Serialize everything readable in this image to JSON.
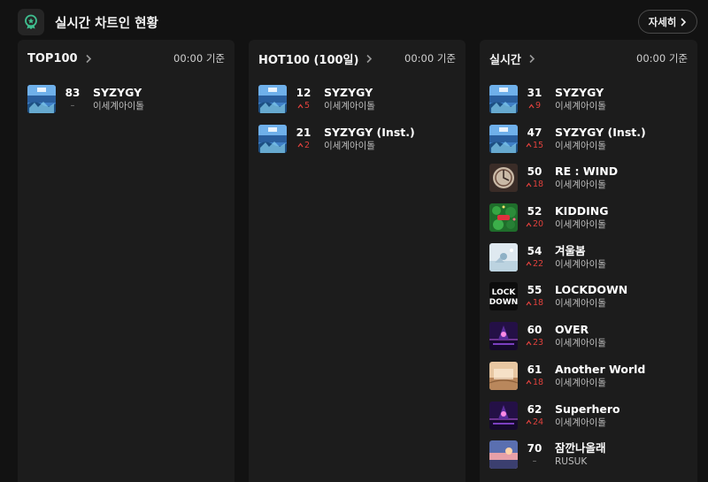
{
  "header": {
    "title": "실시간 차트인 현황",
    "detail_label": "자세히"
  },
  "panels": [
    {
      "name": "TOP100",
      "basis": "00:00 기준",
      "items": [
        {
          "rank": "83",
          "change": "–",
          "dir": "none",
          "title": "SYZYGY",
          "artist": "이세계아이돌",
          "art": "syzygy"
        }
      ]
    },
    {
      "name": "HOT100 (100일)",
      "basis": "00:00 기준",
      "items": [
        {
          "rank": "12",
          "change": "5",
          "dir": "up",
          "title": "SYZYGY",
          "artist": "이세계아이돌",
          "art": "syzygy"
        },
        {
          "rank": "21",
          "change": "2",
          "dir": "up",
          "title": "SYZYGY (Inst.)",
          "artist": "이세계아이돌",
          "art": "syzygy"
        }
      ]
    },
    {
      "name": "실시간",
      "basis": "00:00 기준",
      "items": [
        {
          "rank": "31",
          "change": "9",
          "dir": "up",
          "title": "SYZYGY",
          "artist": "이세계아이돌",
          "art": "syzygy"
        },
        {
          "rank": "47",
          "change": "15",
          "dir": "up",
          "title": "SYZYGY (Inst.)",
          "artist": "이세계아이돌",
          "art": "syzygy"
        },
        {
          "rank": "50",
          "change": "18",
          "dir": "up",
          "title": "RE : WIND",
          "artist": "이세계아이돌",
          "art": "rewind"
        },
        {
          "rank": "52",
          "change": "20",
          "dir": "up",
          "title": "KIDDING",
          "artist": "이세계아이돌",
          "art": "kidding"
        },
        {
          "rank": "54",
          "change": "22",
          "dir": "up",
          "title": "겨울봄",
          "artist": "이세계아이돌",
          "art": "winter"
        },
        {
          "rank": "55",
          "change": "18",
          "dir": "up",
          "title": "LOCKDOWN",
          "artist": "이세계아이돌",
          "art": "lockdown"
        },
        {
          "rank": "60",
          "change": "23",
          "dir": "up",
          "title": "OVER",
          "artist": "이세계아이돌",
          "art": "over"
        },
        {
          "rank": "61",
          "change": "18",
          "dir": "up",
          "title": "Another World",
          "artist": "이세계아이돌",
          "art": "another"
        },
        {
          "rank": "62",
          "change": "24",
          "dir": "up",
          "title": "Superhero",
          "artist": "이세계아이돌",
          "art": "over"
        },
        {
          "rank": "70",
          "change": "–",
          "dir": "none",
          "title": "잠깐나올래",
          "artist": "RUSUK",
          "art": "sunset"
        }
      ]
    }
  ]
}
